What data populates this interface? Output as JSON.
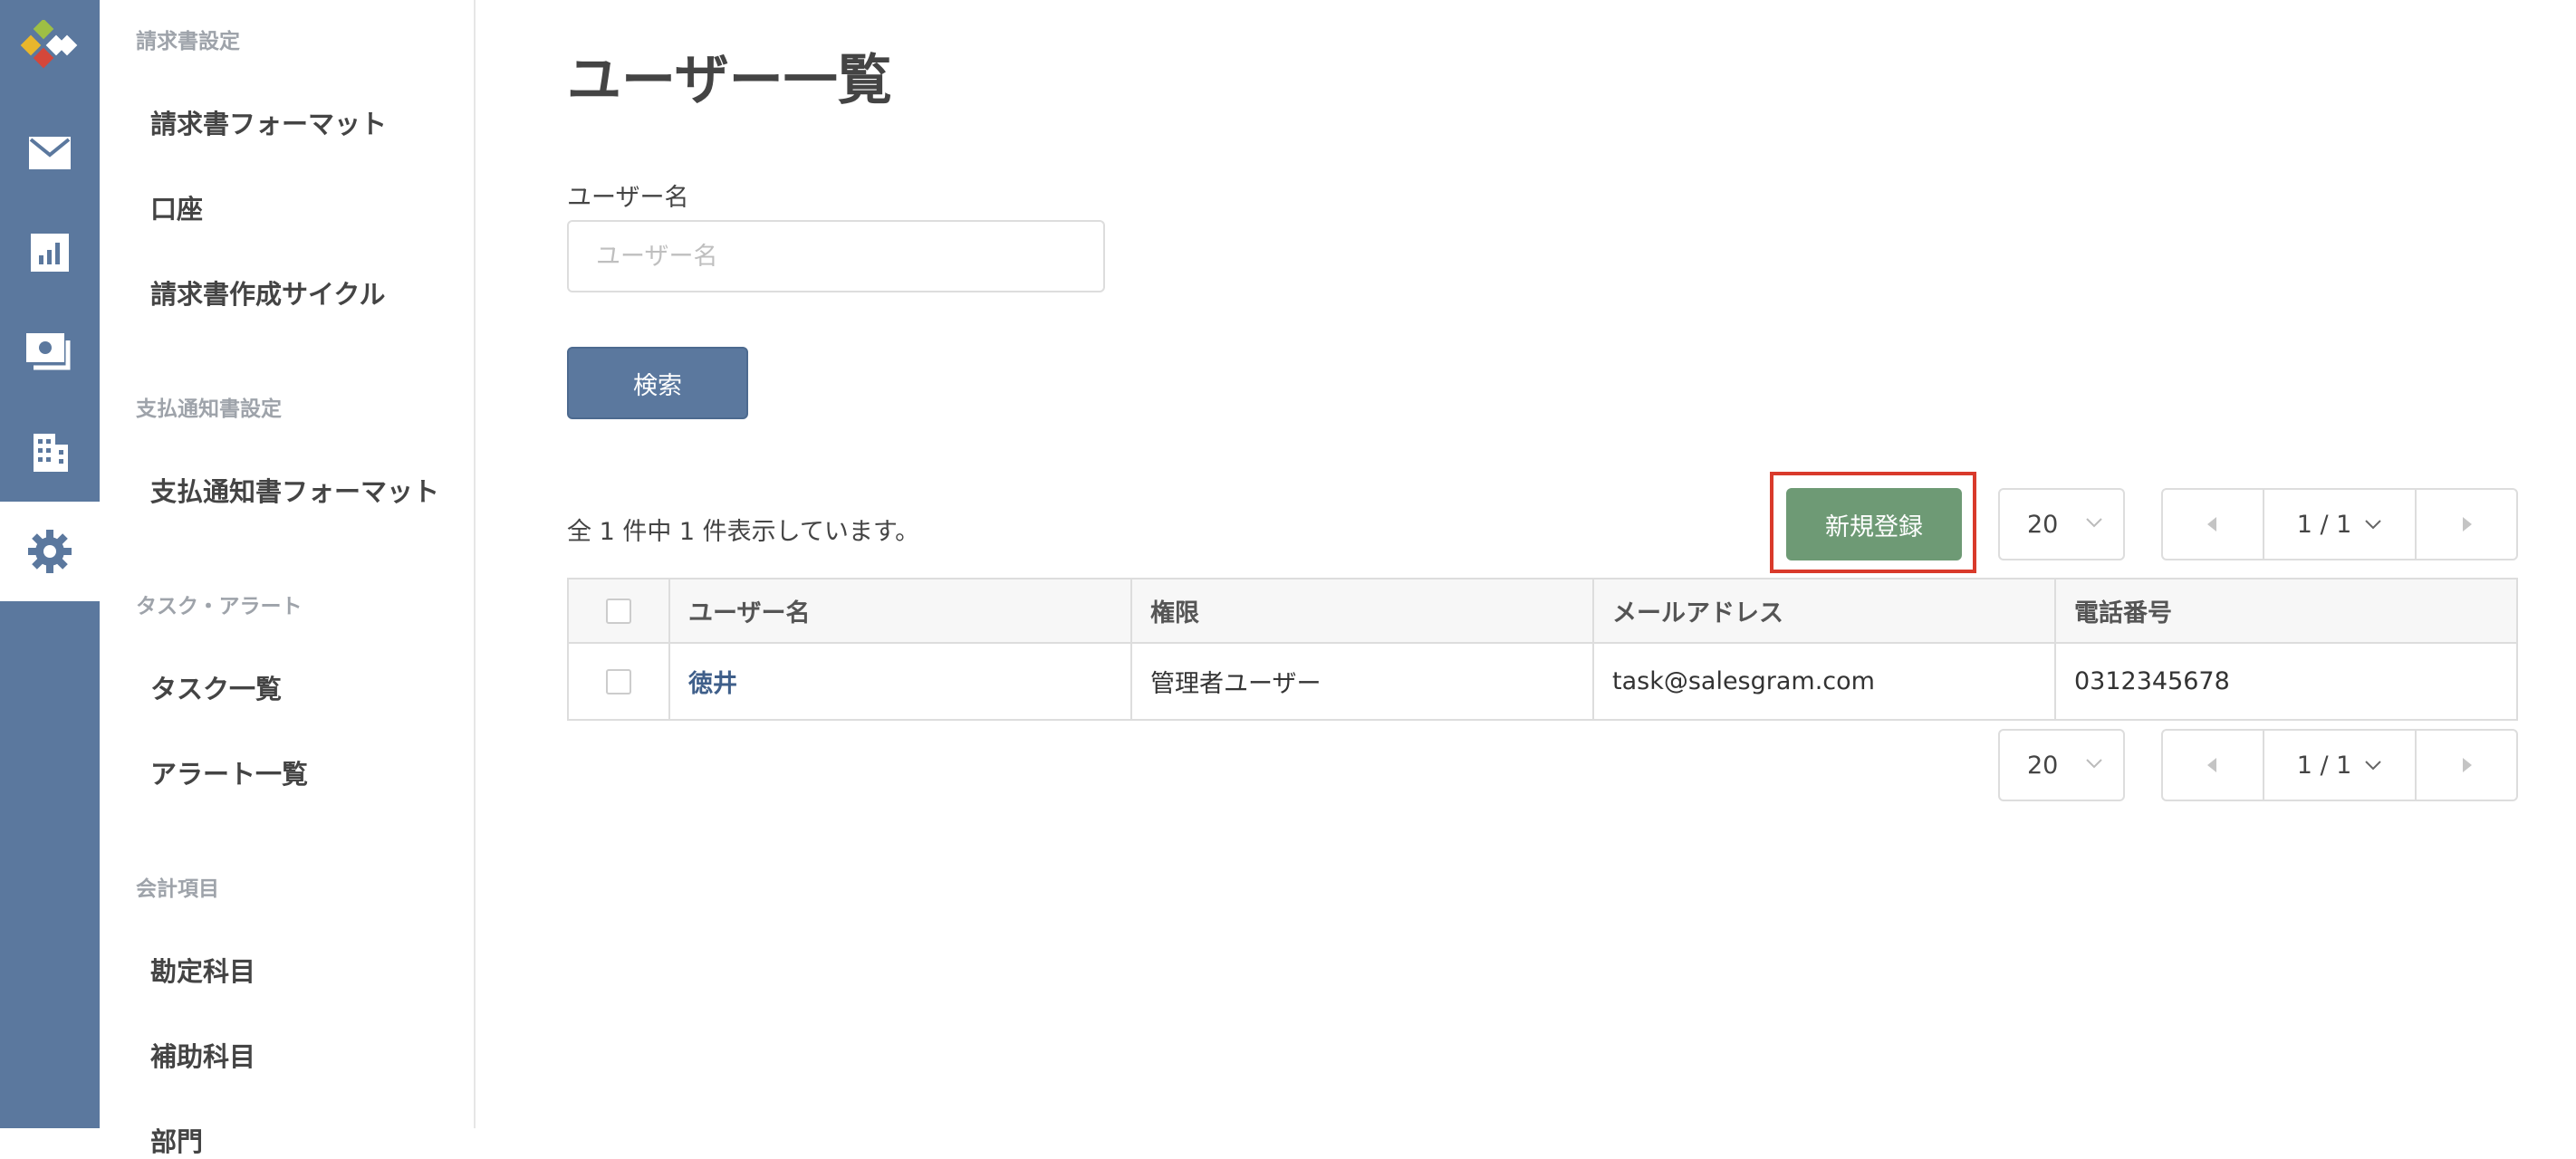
{
  "rail": {
    "items": [
      {
        "icon": "logo-icon"
      },
      {
        "icon": "mail-icon"
      },
      {
        "icon": "bar-chart-icon"
      },
      {
        "icon": "payment-icon"
      },
      {
        "icon": "building-icon"
      },
      {
        "icon": "gear-icon",
        "active": true
      }
    ]
  },
  "sidebar": {
    "sections": [
      {
        "title": "請求書設定",
        "items": [
          "請求書フォーマット",
          "口座",
          "請求書作成サイクル"
        ]
      },
      {
        "title": "支払通知書設定",
        "items": [
          "支払通知書フォーマット"
        ]
      },
      {
        "title": "タスク・アラート",
        "items": [
          "タスク一覧",
          "アラート一覧"
        ]
      },
      {
        "title": "会計項目",
        "items": [
          "勘定科目",
          "補助科目",
          "部門"
        ]
      }
    ]
  },
  "main": {
    "title": "ユーザー一覧",
    "search": {
      "label": "ユーザー名",
      "placeholder": "ユーザー名",
      "value": "",
      "button_label": "検索"
    },
    "count_text": "全 1 件中 1 件表示しています。",
    "new_button_label": "新規登録",
    "per_page": "20",
    "pagination": "1 / 1",
    "table": {
      "headers": [
        "ユーザー名",
        "権限",
        "メールアドレス",
        "電話番号"
      ],
      "rows": [
        {
          "name": "徳井",
          "role": "管理者ユーザー",
          "email": "task@salesgram.com",
          "phone": "0312345678"
        }
      ]
    }
  },
  "colors": {
    "rail": "#5b789e",
    "primary_button": "#5b789e",
    "new_button": "#6e9a75",
    "highlight": "#d93a2b",
    "link": "#3f5f8a"
  }
}
